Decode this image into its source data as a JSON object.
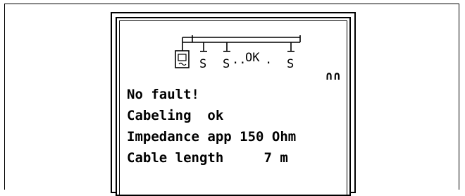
{
  "display": {
    "topology": {
      "segment_labels": [
        "S",
        "S",
        "S"
      ],
      "dots_left": "..",
      "status_label": "OK",
      "dots_right": "."
    },
    "status_symbol": "∩∩",
    "lines": [
      "No fault!",
      "Cabeling  ok",
      "Impedance app 150 Ohm",
      "Cable length     7 m"
    ]
  }
}
